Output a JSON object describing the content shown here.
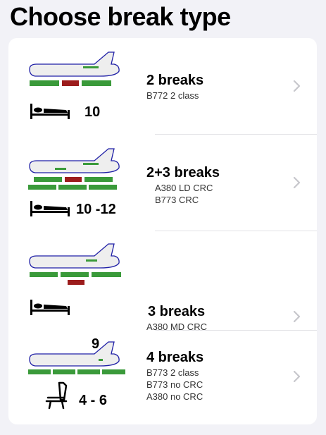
{
  "title": "Choose break type",
  "colors": {
    "background": "#f2f2f7",
    "card": "#ffffff",
    "break_green": "#3a9a3a",
    "break_red": "#9c1c1c",
    "plane_outline": "#1f1fa6",
    "plane_fill": "#eeeeee",
    "chevron": "#c7c7cc"
  },
  "rows": [
    {
      "title": "2 breaks",
      "lines": [
        "B772 2 class"
      ],
      "rest_icon": "bed-icon",
      "rest_value": "10"
    },
    {
      "title": "2+3 breaks",
      "lines": [
        "A380 LD CRC",
        "B773 CRC"
      ],
      "rest_icon": "bed-icon",
      "rest_value": "10 -12"
    },
    {
      "title": "3 breaks",
      "lines": [
        "A380 MD CRC"
      ],
      "rest_icon": "bed-icon",
      "rest_value": "9"
    },
    {
      "title": "4 breaks",
      "lines": [
        "B773 2 class",
        "B773 no CRC",
        "A380 no CRC"
      ],
      "rest_icon": "seat-icon",
      "rest_value": "4 - 6"
    }
  ]
}
